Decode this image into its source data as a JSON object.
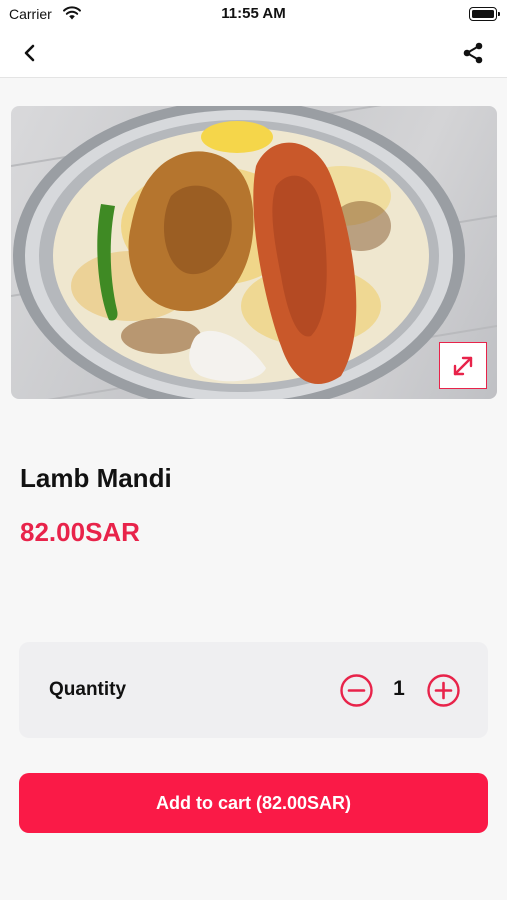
{
  "status_bar": {
    "carrier": "Carrier",
    "time": "11:55 AM"
  },
  "nav": {
    "back_icon": "chevron-left-icon",
    "share_icon": "share-icon"
  },
  "product": {
    "image_icon": "expand-icon",
    "name": "Lamb Mandi",
    "price": "82.00SAR"
  },
  "quantity": {
    "label": "Quantity",
    "value": "1",
    "minus_icon": "minus-circle-icon",
    "plus_icon": "plus-circle-icon"
  },
  "cart": {
    "button_label": "Add to cart (82.00SAR)"
  },
  "colors": {
    "accent": "#e8234a",
    "button": "#fa1a47",
    "background": "#f7f7f7",
    "card": "#efeff1"
  }
}
